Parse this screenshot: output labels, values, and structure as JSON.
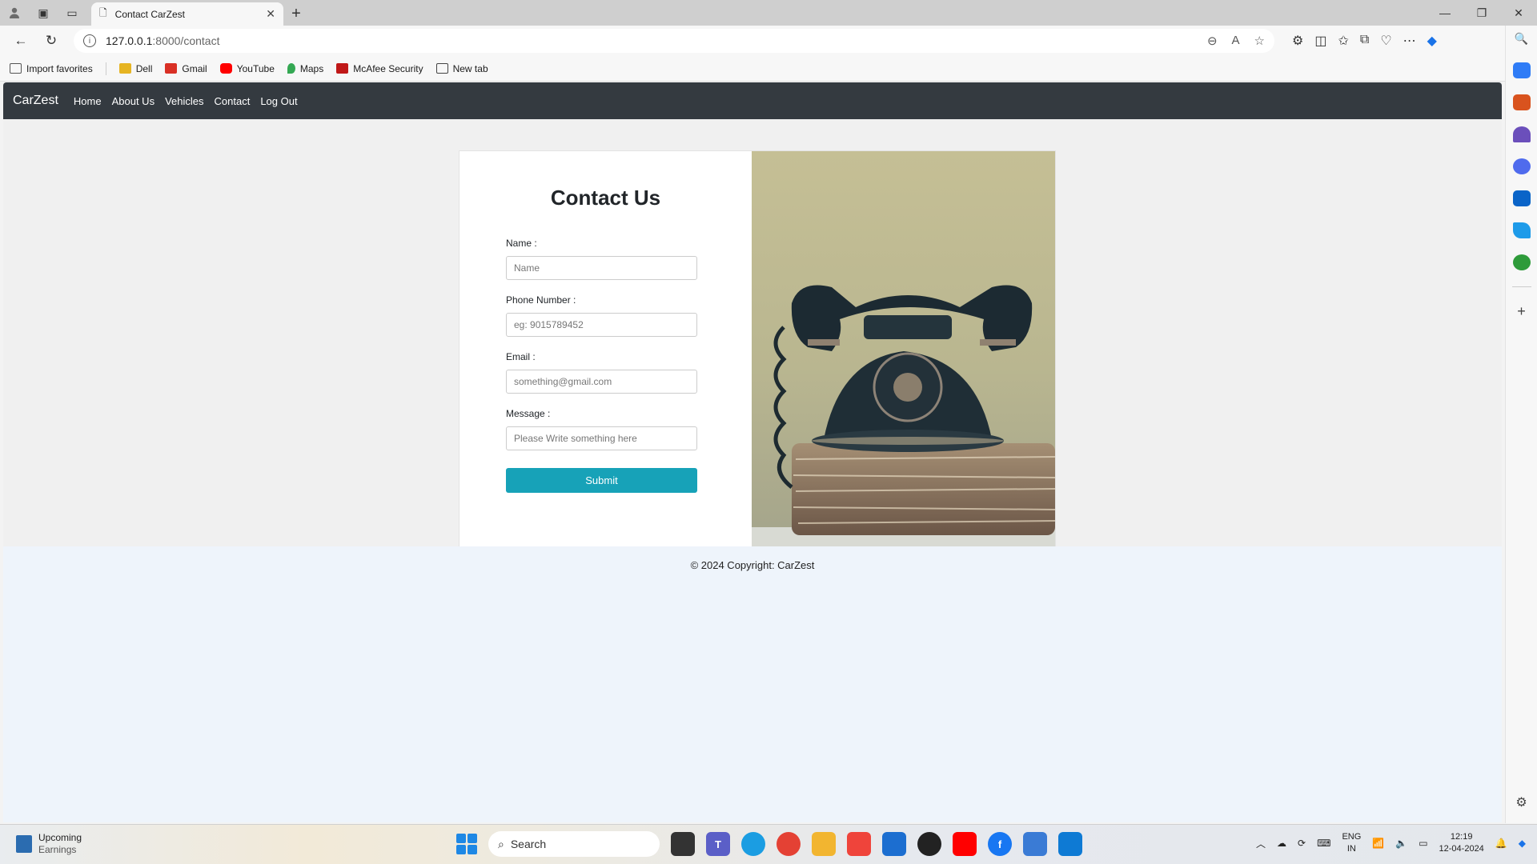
{
  "browser": {
    "tab_title": "Contact CarZest",
    "url_host": "127.0.0.1",
    "url_path": ":8000/contact",
    "favorites": [
      {
        "label": "Import favorites",
        "color": "#555555"
      },
      {
        "label": "Dell",
        "color": "#e6b422"
      },
      {
        "label": "Gmail",
        "color": "#d93025"
      },
      {
        "label": "YouTube",
        "color": "#ff0000"
      },
      {
        "label": "Maps",
        "color": "#34a853"
      },
      {
        "label": "McAfee Security",
        "color": "#c01818"
      },
      {
        "label": "New tab",
        "color": "#444444"
      }
    ]
  },
  "site": {
    "brand": "CarZest",
    "nav": [
      "Home",
      "About Us",
      "Vehicles",
      "Contact",
      "Log Out"
    ],
    "colors": {
      "navbar": "#343a40",
      "button": "#17a2b8"
    }
  },
  "form": {
    "title": "Contact Us",
    "name_label": "Name :",
    "name_placeholder": "Name",
    "phone_label": "Phone Number :",
    "phone_placeholder": "eg: 9015789452",
    "email_label": "Email :",
    "email_placeholder": "something@gmail.com",
    "message_label": "Message :",
    "message_placeholder": "Please Write something here",
    "submit_label": "Submit"
  },
  "footer": {
    "text": "© 2024 Copyright: CarZest"
  },
  "taskbar": {
    "weather_title": "Upcoming",
    "weather_sub": "Earnings",
    "search_label": "Search",
    "lang_1": "ENG",
    "lang_2": "IN",
    "time": "12:19",
    "date": "12-04-2024"
  }
}
